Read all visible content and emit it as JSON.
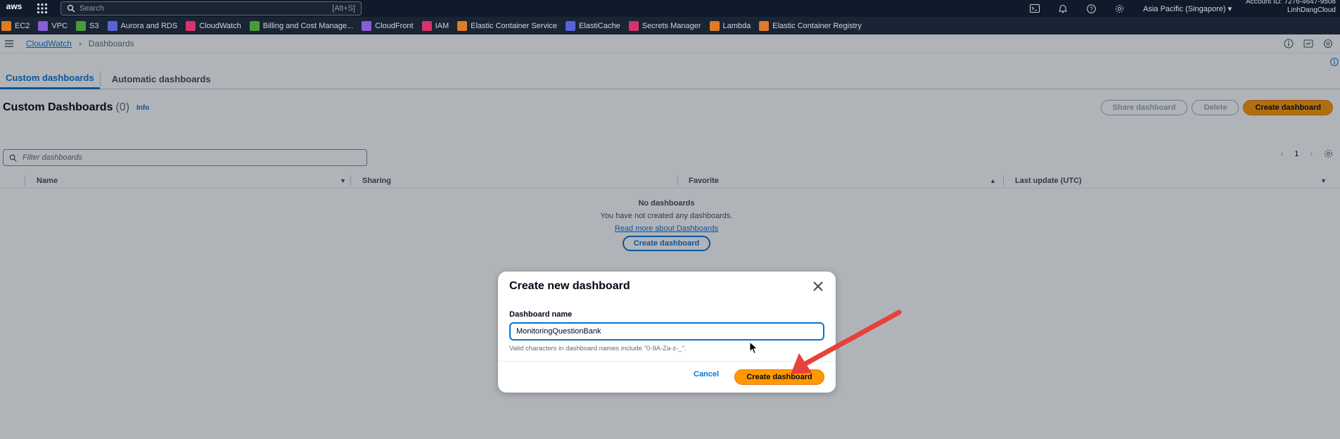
{
  "topnav": {
    "logo": "aws",
    "search_placeholder": "Search",
    "search_hint": "[Alt+S]",
    "region": "Asia Pacific (Singapore)",
    "account_id": "Account ID: 7276-4647-9508",
    "account_name": "LinhDangCloud"
  },
  "favorites": [
    {
      "label": "EC2",
      "color": "#e07b29"
    },
    {
      "label": "VPC",
      "color": "#8a5cd6"
    },
    {
      "label": "S3",
      "color": "#4c9a3a"
    },
    {
      "label": "Aurora and RDS",
      "color": "#5a63d6"
    },
    {
      "label": "CloudWatch",
      "color": "#d6336c"
    },
    {
      "label": "Billing and Cost Manage...",
      "color": "#4c9a3a"
    },
    {
      "label": "CloudFront",
      "color": "#8a5cd6"
    },
    {
      "label": "IAM",
      "color": "#d6336c"
    },
    {
      "label": "Elastic Container Service",
      "color": "#e07b29"
    },
    {
      "label": "ElastiCache",
      "color": "#5a63d6"
    },
    {
      "label": "Secrets Manager",
      "color": "#d6336c"
    },
    {
      "label": "Lambda",
      "color": "#e07b29"
    },
    {
      "label": "Elastic Container Registry",
      "color": "#e07b29"
    }
  ],
  "breadcrumb": {
    "root": "CloudWatch",
    "current": "Dashboards"
  },
  "tabs": [
    "Custom dashboards",
    "Automatic dashboards"
  ],
  "header": {
    "title": "Custom Dashboards",
    "count": "(0)",
    "info": "Info",
    "share_label": "Share dashboard",
    "delete_label": "Delete",
    "create_label": "Create dashboard"
  },
  "filter": {
    "placeholder": "Filter dashboards"
  },
  "pager": {
    "page": "1"
  },
  "table": {
    "columns": [
      "Name",
      "Sharing",
      "Favorite",
      "Last update (UTC)"
    ]
  },
  "empty": {
    "title": "No dashboards",
    "message": "You have not created any dashboards.",
    "link": "Read more about Dashboards",
    "button": "Create dashboard"
  },
  "modal": {
    "title": "Create new dashboard",
    "field_label": "Dashboard name",
    "field_value": "MonitoringQuestionBank",
    "constraint": "Valid characters in dashboard names include \"0-9A-Za-z-_\".",
    "cancel_label": "Cancel",
    "create_label": "Create dashboard"
  },
  "colors": {
    "accent": "#0972d3",
    "primary_button": "#ff9900",
    "annotation_arrow": "#e8403a",
    "nav_bg": "#0f1b2a"
  }
}
